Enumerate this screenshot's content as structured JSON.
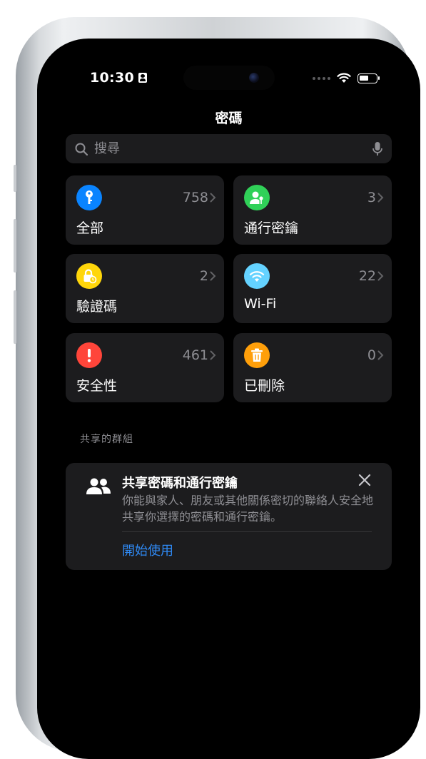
{
  "status_bar": {
    "time": "10:30"
  },
  "nav": {
    "title": "密碼"
  },
  "search": {
    "placeholder": "搜尋"
  },
  "categories": [
    {
      "label": "全部",
      "count": "758",
      "icon": "key-icon",
      "color": "#0a84ff"
    },
    {
      "label": "通行密鑰",
      "count": "3",
      "icon": "person-key-icon",
      "color": "#30d158"
    },
    {
      "label": "驗證碼",
      "count": "2",
      "icon": "lock-clock-icon",
      "color": "#ffd60a"
    },
    {
      "label": "Wi-Fi",
      "count": "22",
      "icon": "wifi-icon",
      "color": "#64d2ff"
    },
    {
      "label": "安全性",
      "count": "461",
      "icon": "exclamation-icon",
      "color": "#ff453a"
    },
    {
      "label": "已刪除",
      "count": "0",
      "icon": "trash-icon",
      "color": "#ff9f0a"
    }
  ],
  "shared_groups": {
    "header": "共享的群組",
    "card": {
      "title": "共享密碼和通行密鑰",
      "description": "你能與家人、朋友或其他關係密切的聯絡人安全地共享你選擇的密碼和通行密鑰。",
      "action": "開始使用"
    }
  },
  "colors": {
    "accent": "#2f8af5",
    "background": "#000000",
    "tile": "#1c1c1e"
  }
}
